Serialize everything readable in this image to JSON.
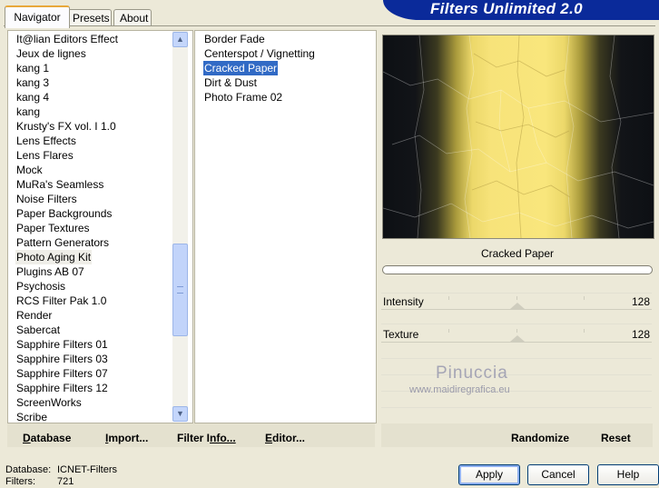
{
  "tabs": [
    {
      "label": "Navigator",
      "active": true
    },
    {
      "label": "Presets",
      "active": false
    },
    {
      "label": "About",
      "active": false
    }
  ],
  "app_title": "Filters Unlimited 2.0",
  "categories": [
    "It@lian Editors Effect",
    "Jeux de lignes",
    "kang 1",
    "kang 3",
    "kang 4",
    "kang",
    "Krusty's FX vol. I 1.0",
    "Lens Effects",
    "Lens Flares",
    "Mock",
    "MuRa's Seamless",
    "Noise Filters",
    "Paper Backgrounds",
    "Paper Textures",
    "Pattern Generators",
    "Photo Aging Kit",
    "Plugins AB 07",
    "Psychosis",
    "RCS Filter Pak 1.0",
    "Render",
    "Sabercat",
    "Sapphire Filters 01",
    "Sapphire Filters 03",
    "Sapphire Filters 07",
    "Sapphire Filters 12",
    "ScreenWorks",
    "Scribe"
  ],
  "selected_category": "Photo Aging Kit",
  "filters": [
    "Border Fade",
    "Centerspot / Vignetting",
    "Cracked Paper",
    "Dirt & Dust",
    "Photo Frame 02"
  ],
  "selected_filter": "Cracked Paper",
  "preview": {
    "filter_name": "Cracked Paper"
  },
  "sliders": [
    {
      "label": "Intensity",
      "value": "128"
    },
    {
      "label": "Texture",
      "value": "128"
    }
  ],
  "watermark": {
    "name": "Pinuccia",
    "url": "www.maidiregrafica.eu"
  },
  "bottom_buttons_left": [
    {
      "key": "D",
      "rest": "atabase"
    },
    {
      "key": "I",
      "rest": "mport..."
    },
    {
      "key": "Filter I",
      "rest": "nfo..."
    },
    {
      "key": "E",
      "rest": "ditor..."
    }
  ],
  "bottom_buttons_right": {
    "randomize": "Randomize",
    "reset": "Reset"
  },
  "status": {
    "database_label": "Database:",
    "database_value": "ICNET-Filters",
    "filters_label": "Filters:",
    "filters_value": "721"
  },
  "dialog_buttons": {
    "apply": "Apply",
    "cancel": "Cancel",
    "help": "Help"
  },
  "icons": {
    "up": "scroll-up-arrow",
    "down": "scroll-down-arrow"
  },
  "colors": {
    "title_banner": "#0a2a9a",
    "selection": "#316ac5",
    "preview_yellow": "#f9e67c"
  }
}
